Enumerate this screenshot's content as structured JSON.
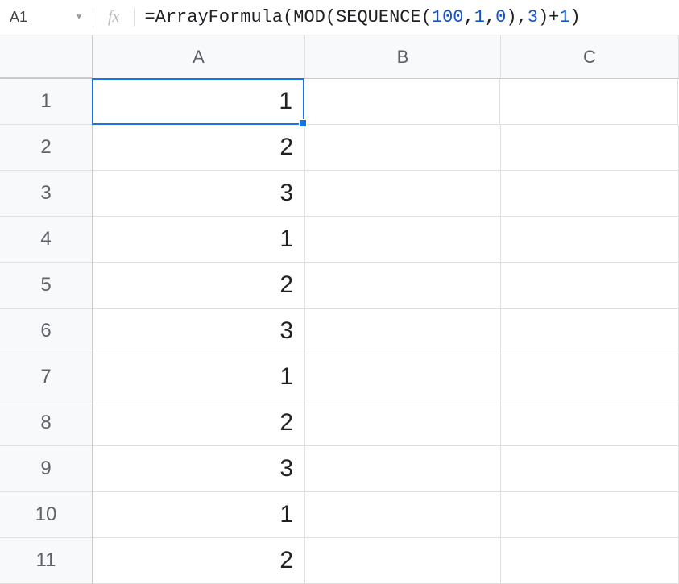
{
  "nameBox": "A1",
  "fxLabel": "fx",
  "formula": {
    "p1": "=ArrayFormula(MOD(SEQUENCE(",
    "n1": "100",
    "c1": ",",
    "n2": "1",
    "c2": ",",
    "n3": "0",
    "p2": "),",
    "n4": "3",
    "p3": ")+",
    "n5": "1",
    "p4": ")"
  },
  "columns": [
    "A",
    "B",
    "C"
  ],
  "rows": [
    "1",
    "2",
    "3",
    "4",
    "5",
    "6",
    "7",
    "8",
    "9",
    "10",
    "11"
  ],
  "cells": {
    "A": [
      "1",
      "2",
      "3",
      "1",
      "2",
      "3",
      "1",
      "2",
      "3",
      "1",
      "2"
    ],
    "B": [
      "",
      "",
      "",
      "",
      "",
      "",
      "",
      "",
      "",
      "",
      ""
    ],
    "C": [
      "",
      "",
      "",
      "",
      "",
      "",
      "",
      "",
      "",
      "",
      ""
    ]
  },
  "activeCell": "A1"
}
